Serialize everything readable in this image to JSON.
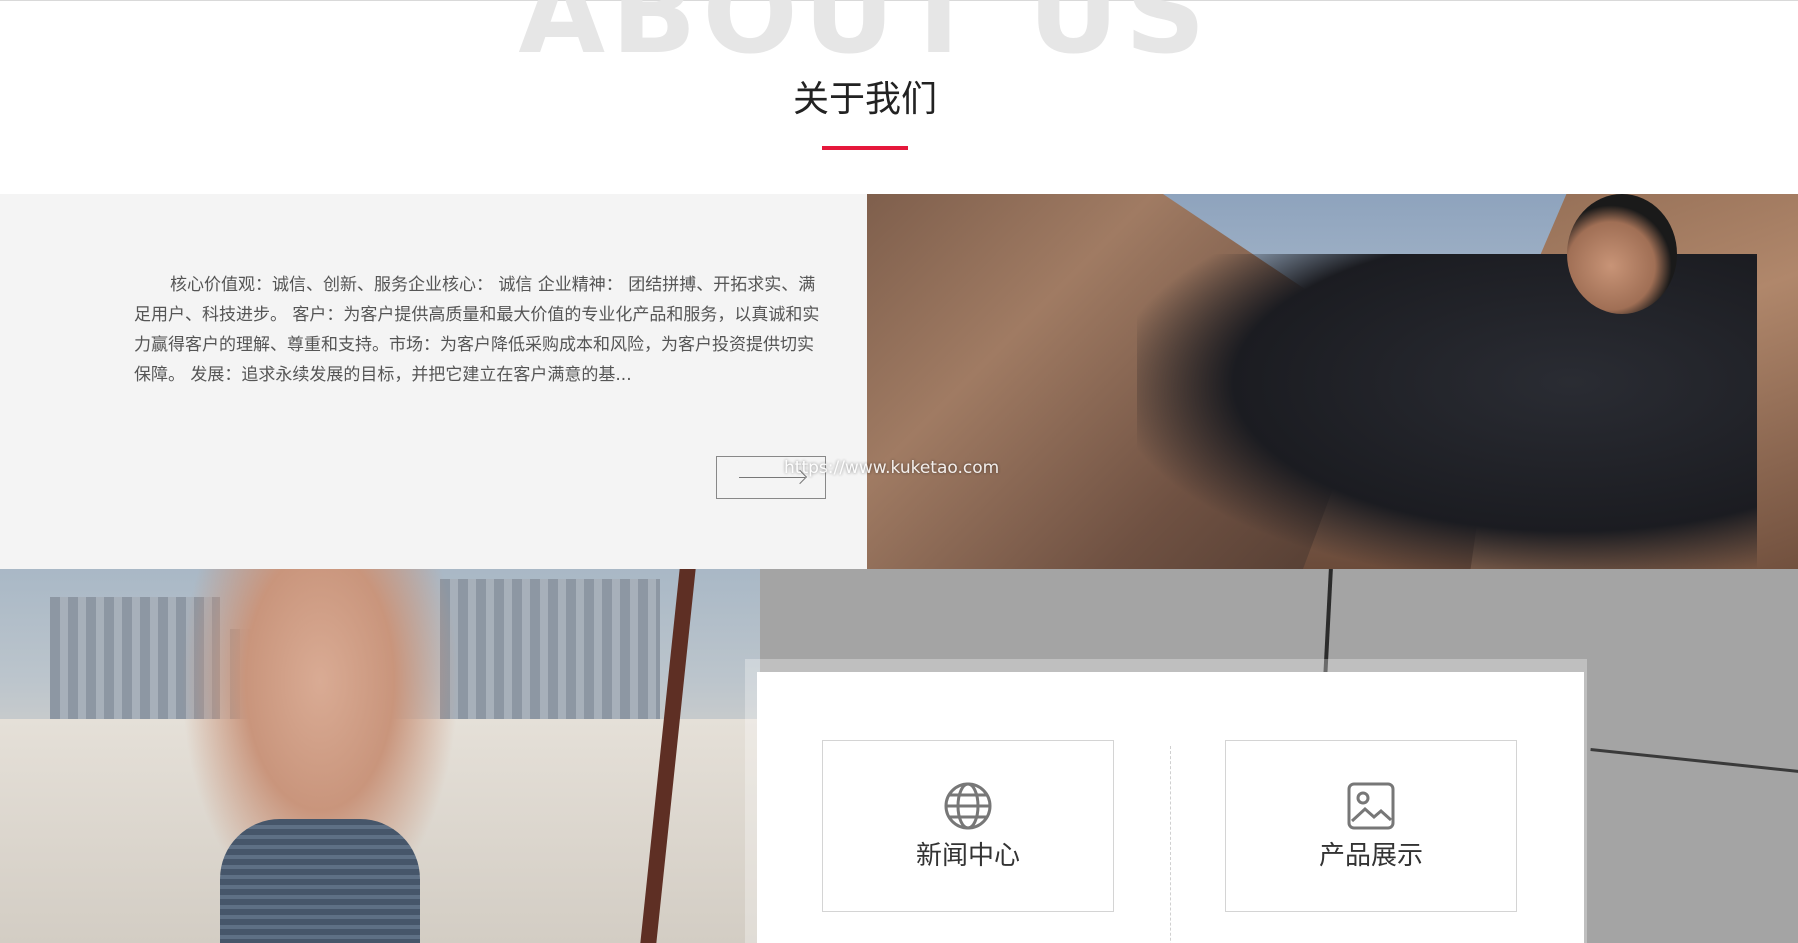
{
  "header": {
    "bg_word": "ABOUT US",
    "title": "关于我们"
  },
  "intro": {
    "text": "核心价值观：诚信、创新、服务企业核心： 诚信 企业精神： 团结拼搏、开拓求实、满足用户、科技进步。 客户：为客户提供高质量和最大价值的专业化产品和服务，以真诚和实力赢得客户的理解、尊重和支持。市场：为客户降低采购成本和风险，为客户投资提供切实保障。 发展：追求永续发展的目标，并把它建立在客户满意的基..."
  },
  "watermark": "https://www.kuketao.com",
  "links": [
    {
      "label": "新闻中心",
      "icon": "globe-icon"
    },
    {
      "label": "产品展示",
      "icon": "image-icon"
    }
  ],
  "colors": {
    "accent": "#e5183b",
    "panel_bg": "#f4f4f4",
    "text": "#555555"
  }
}
